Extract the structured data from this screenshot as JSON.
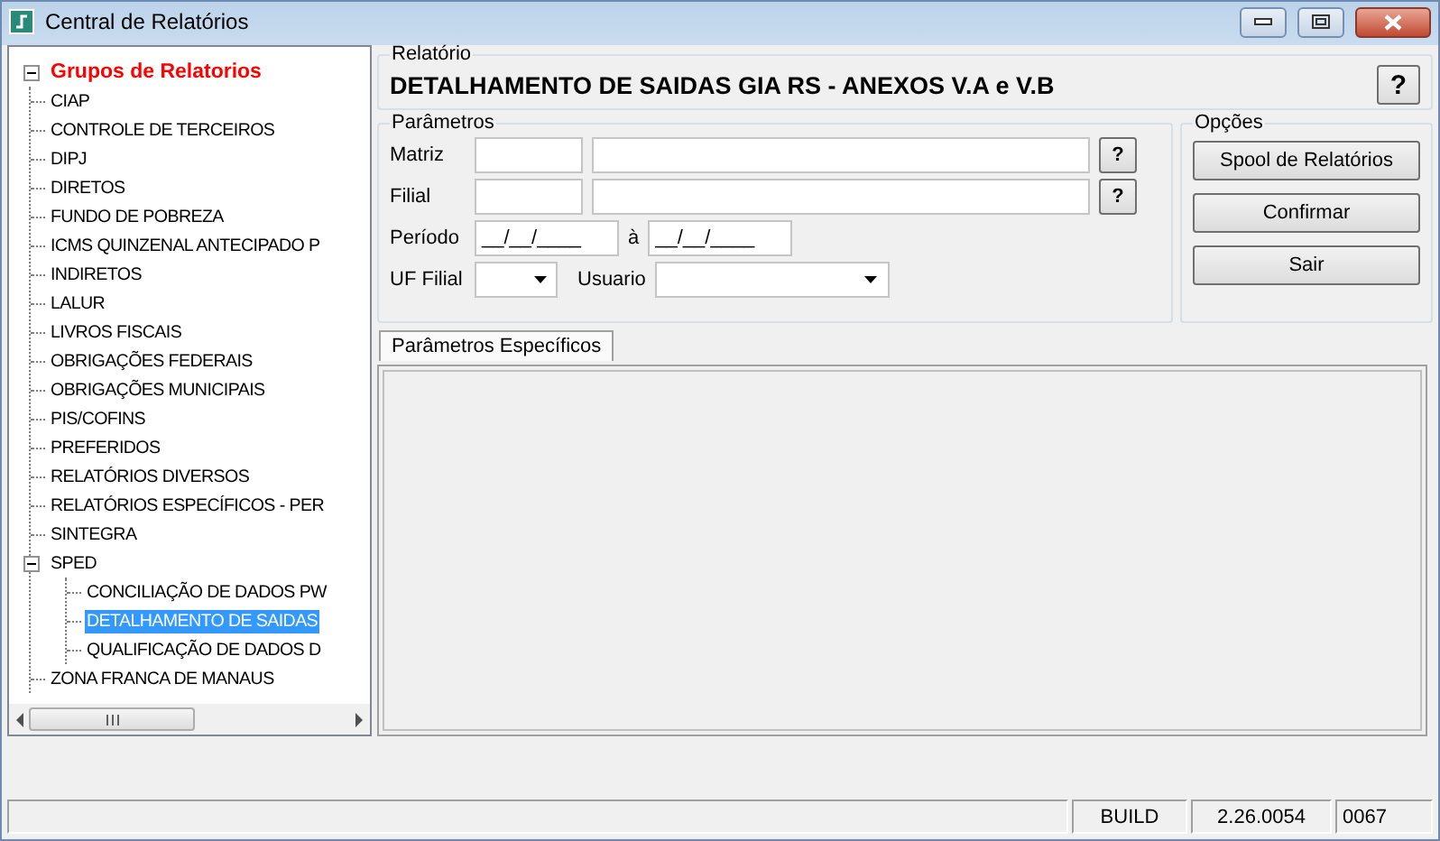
{
  "window": {
    "title": "Central de Relatórios"
  },
  "tree": {
    "items": [
      {
        "label": "Grupos de Relatorios",
        "expanded": true,
        "selected": false,
        "children": [
          {
            "label": "CIAP",
            "selected": false
          },
          {
            "label": "CONTROLE DE TERCEIROS",
            "selected": false
          },
          {
            "label": "DIPJ",
            "selected": false
          },
          {
            "label": "DIRETOS",
            "selected": false
          },
          {
            "label": "FUNDO DE POBREZA",
            "selected": false
          },
          {
            "label": "ICMS QUINZENAL ANTECIPADO P",
            "selected": false
          },
          {
            "label": "INDIRETOS",
            "selected": false
          },
          {
            "label": "LALUR",
            "selected": false
          },
          {
            "label": "LIVROS FISCAIS",
            "selected": false
          },
          {
            "label": "OBRIGAÇÕES FEDERAIS",
            "selected": false
          },
          {
            "label": "OBRIGAÇÕES MUNICIPAIS",
            "selected": false
          },
          {
            "label": "PIS/COFINS",
            "selected": false
          },
          {
            "label": "PREFERIDOS",
            "selected": false
          },
          {
            "label": "RELATÓRIOS DIVERSOS",
            "selected": false
          },
          {
            "label": "RELATÓRIOS ESPECÍFICOS - PER",
            "selected": false
          },
          {
            "label": "SINTEGRA",
            "selected": false
          },
          {
            "label": "SPED",
            "expanded": true,
            "selected": false,
            "children": [
              {
                "label": "CONCILIAÇÃO DE DADOS PW",
                "selected": false
              },
              {
                "label": "DETALHAMENTO DE SAIDAS",
                "selected": true
              },
              {
                "label": "QUALIFICAÇÃO DE DADOS D",
                "selected": false
              }
            ]
          },
          {
            "label": "ZONA FRANCA DE MANAUS",
            "selected": false
          }
        ]
      }
    ]
  },
  "relatorio": {
    "legend": "Relatório",
    "title": "DETALHAMENTO DE SAIDAS GIA RS - ANEXOS V.A e V.B",
    "help": "?"
  },
  "parametros": {
    "legend": "Parâmetros",
    "matriz": {
      "label": "Matriz",
      "help": "?"
    },
    "filial": {
      "label": "Filial",
      "help": "?"
    },
    "periodo": {
      "label": "Período",
      "from": "__/__/____",
      "separator": "à",
      "to": "__/__/____"
    },
    "uf": {
      "label": "UF Filial"
    },
    "usuario": {
      "label": "Usuario"
    }
  },
  "opcoes": {
    "legend": "Opções",
    "buttons": [
      "Spool de Relatórios",
      "Confirmar",
      "Sair"
    ]
  },
  "tabs": [
    {
      "label": "Parâmetros Específicos",
      "selected": true
    }
  ],
  "status_bar": [
    "BUILD",
    "2.26.0054",
    "0067"
  ]
}
